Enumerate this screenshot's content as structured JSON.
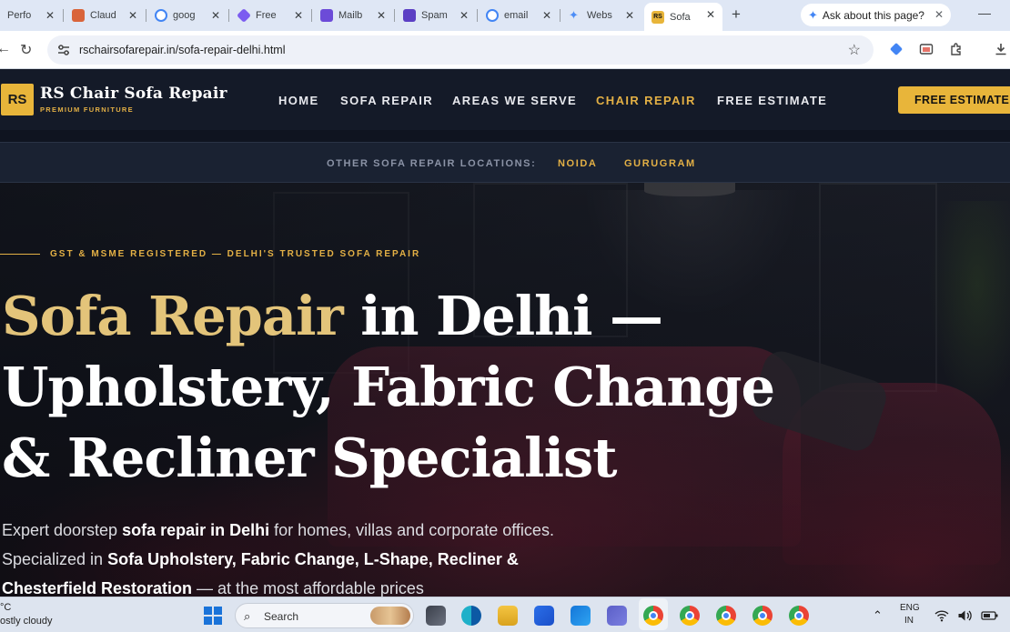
{
  "browser": {
    "tabs": [
      {
        "title": "Perfo",
        "favicon_color": "#6b4bd6"
      },
      {
        "title": "Claud",
        "favicon_color": "#d9643a"
      },
      {
        "title": "goog",
        "favicon_color": "#4285f4"
      },
      {
        "title": "Free",
        "favicon_color": "#7b5cf0"
      },
      {
        "title": "Mailb",
        "favicon_color": "#6c4bd8"
      },
      {
        "title": "Spam",
        "favicon_color": "#5b3fc4"
      },
      {
        "title": "email",
        "favicon_color": "#4285f4"
      },
      {
        "title": "Webs",
        "favicon_color": "#4c8df6"
      },
      {
        "title": "Sofa",
        "favicon_color": "#e8b53a",
        "favicon_text": "RS",
        "active": true
      }
    ],
    "ask_page": "Ask about this page?",
    "url": "rschairsofarepair.in/sofa-repair-delhi.html",
    "icons": [
      "back-icon",
      "reload-icon",
      "site-info-icon",
      "bookmark-star-icon",
      "google-lens-icon",
      "cast-icon",
      "extensions-icon",
      "download-icon"
    ]
  },
  "site": {
    "logo_initials": "RS",
    "logo_title": "RS Chair Sofa Repair",
    "logo_subtitle": "PREMIUM FURNITURE",
    "nav": [
      {
        "label": "HOME",
        "active": false
      },
      {
        "label": "SOFA REPAIR",
        "active": false
      },
      {
        "label": "AREAS WE SERVE",
        "active": false
      },
      {
        "label": "CHAIR REPAIR",
        "active": true
      },
      {
        "label": "FREE ESTIMATE",
        "active": false
      }
    ],
    "cta_label": "FREE ESTIMATE",
    "accent_color": "#e3b045",
    "locations": {
      "label": "OTHER SOFA REPAIR LOCATIONS:",
      "links": [
        "NOIDA",
        "GURUGRAM"
      ]
    },
    "hero": {
      "eyebrow": "GST & MSME REGISTERED — DELHI'S TRUSTED SOFA REPAIR",
      "headline_highlight": "Sofa Repair",
      "headline_line1_rest": " in Delhi —",
      "headline_line2": "Upholstery, Fabric Change",
      "headline_line3": "& Recliner Specialist",
      "lead_1": "Expert doorstep ",
      "lead_2": "sofa repair in Delhi",
      "lead_3": " for homes, villas and corporate offices. Specialized in ",
      "lead_4": "Sofa Upholstery, Fabric Change, L-Shape, Recliner & Chesterfield Restoration",
      "lead_5": " — at the most affordable prices"
    }
  },
  "taskbar": {
    "weather_temp": "°C",
    "weather_desc": "ostly cloudy",
    "search_label": "Search",
    "lang_1": "ENG",
    "lang_2": "IN"
  }
}
